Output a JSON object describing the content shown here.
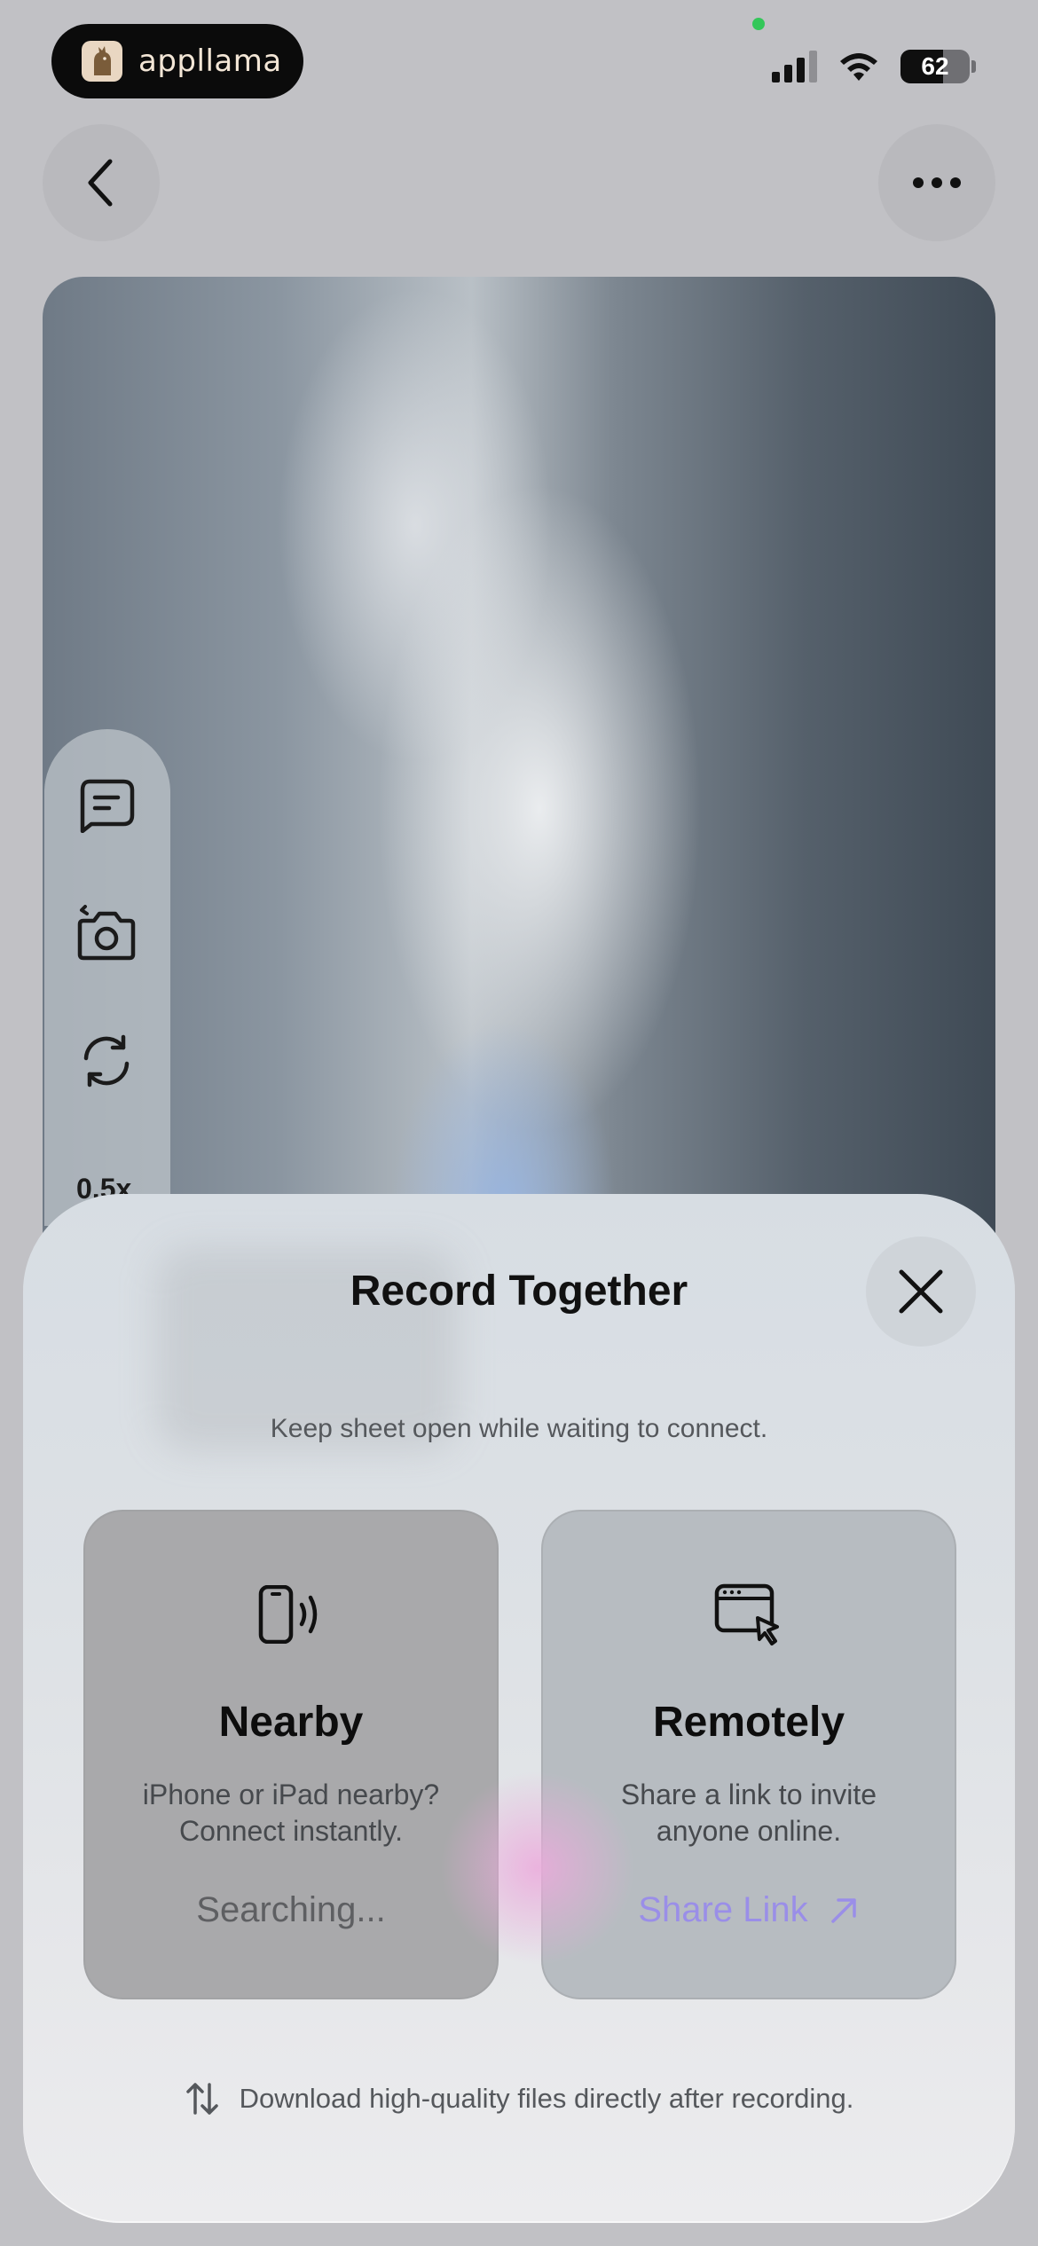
{
  "status_bar": {
    "app_name": "appllama",
    "battery_level": "62",
    "battery_fraction": 0.62
  },
  "navigation": {
    "back_icon": "chevron-left-icon",
    "more_icon": "ellipsis-icon"
  },
  "toolbar": {
    "zoom_label": "0.5x",
    "icons": [
      "chat-icon",
      "camera-icon",
      "flip-camera-icon"
    ]
  },
  "sheet": {
    "title": "Record Together",
    "subtitle": "Keep sheet open while waiting to connect.",
    "options": [
      {
        "title": "Nearby",
        "description": "iPhone or iPad nearby? Connect instantly.",
        "action": "Searching...",
        "icon": "phone-wireless-icon"
      },
      {
        "title": "Remotely",
        "description": "Share a link to invite anyone online.",
        "action": "Share Link",
        "icon": "browser-cursor-icon"
      }
    ],
    "footer": "Download high-quality files directly after recording."
  },
  "colors": {
    "accent": "#9a8ee8",
    "status_dot": "#33c759"
  }
}
